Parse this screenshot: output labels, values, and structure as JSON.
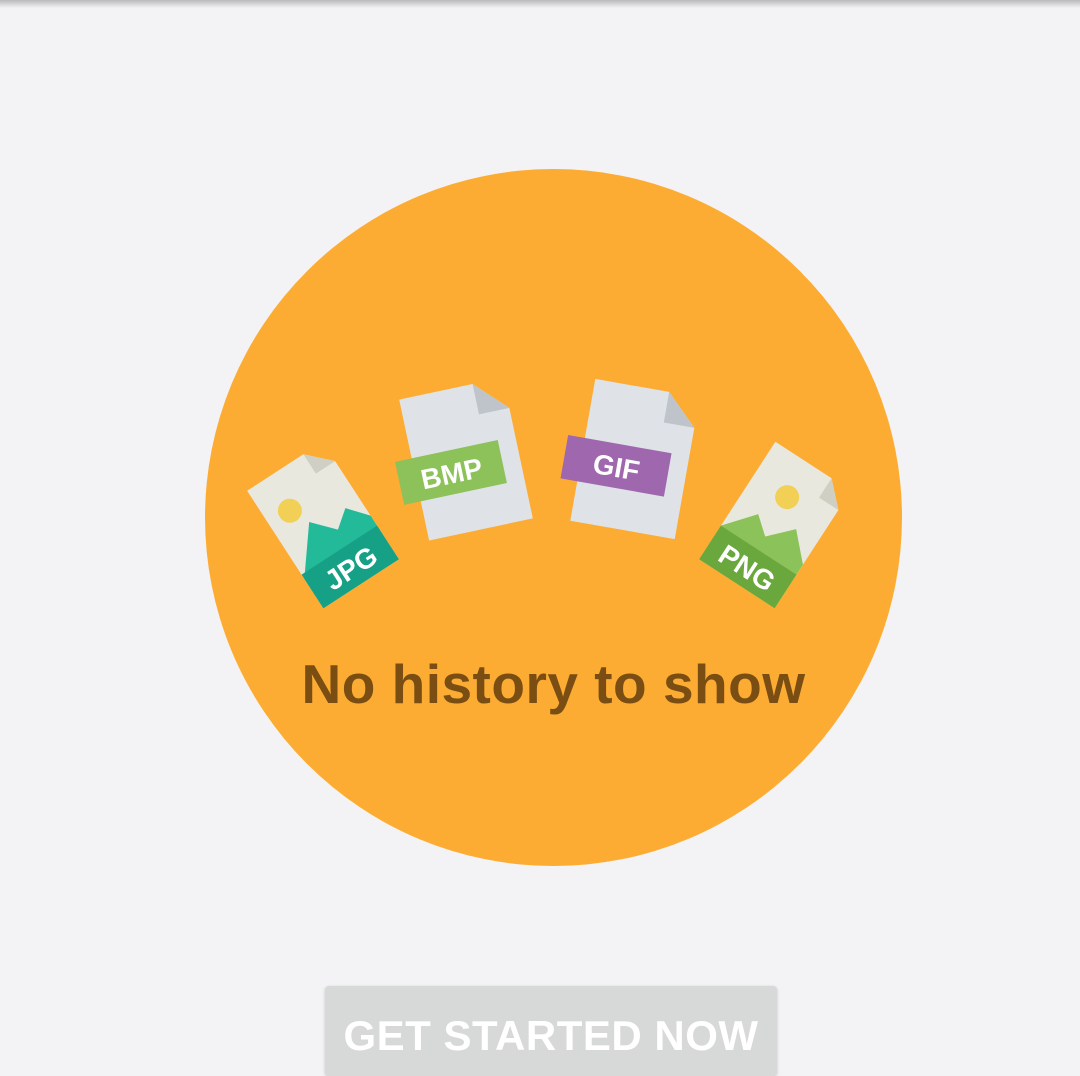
{
  "empty_state": {
    "message": "No history to show",
    "file_types": [
      "JPG",
      "BMP",
      "GIF",
      "PNG"
    ]
  },
  "actions": {
    "primary_label": "GET STARTED NOW"
  },
  "colors": {
    "background": "#f3f3f5",
    "circle": "#fdac33",
    "message_text": "#7a4e13",
    "button": "#d7d8d8",
    "jpg_badge": "#1aa385",
    "bmp_badge": "#8cc25a",
    "gif_badge": "#9f67ad",
    "png_badge": "#6aa73c"
  }
}
